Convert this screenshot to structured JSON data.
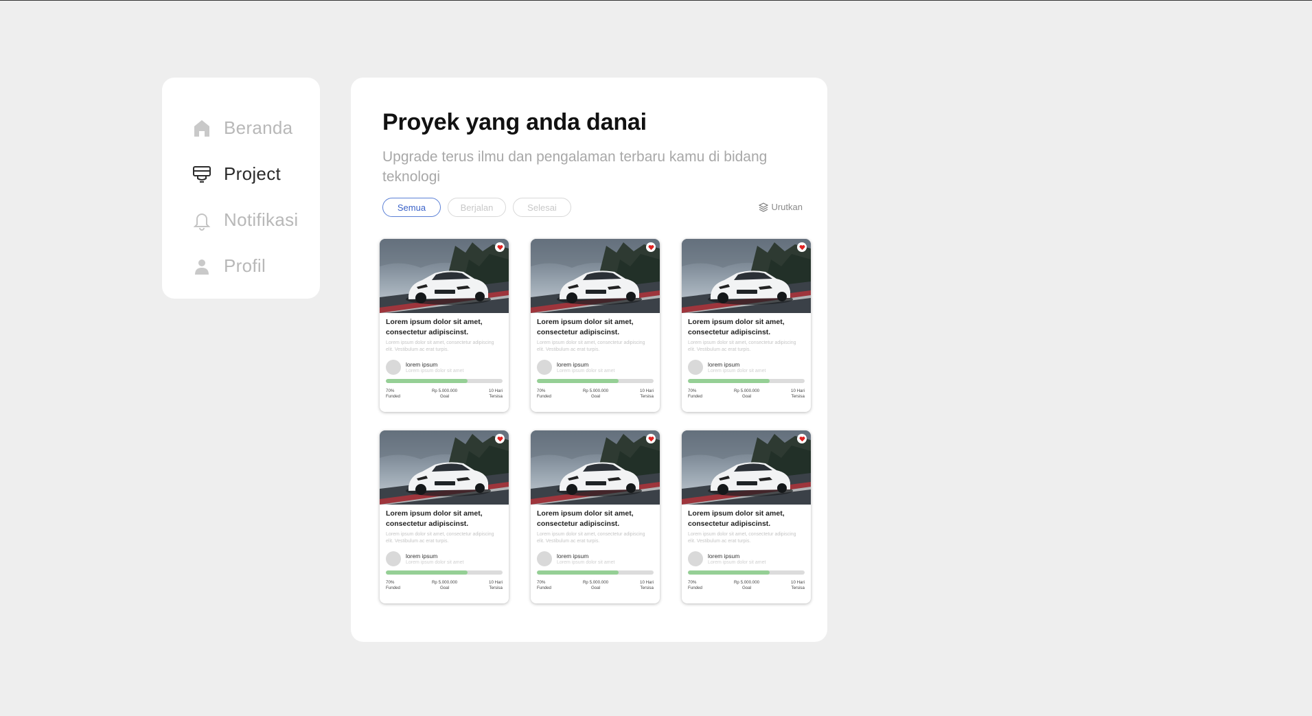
{
  "sidebar": {
    "items": [
      {
        "label": "Beranda",
        "icon": "home-icon",
        "active": false
      },
      {
        "label": "Project",
        "icon": "project-icon",
        "active": true
      },
      {
        "label": "Notifikasi",
        "icon": "bell-icon",
        "active": false
      },
      {
        "label": "Profil",
        "icon": "user-icon",
        "active": false
      }
    ]
  },
  "main": {
    "title": "Proyek yang anda danai",
    "subtitle": "Upgrade terus ilmu dan pengalaman terbaru kamu di bidang teknologi",
    "filters": [
      "Semua",
      "Berjalan",
      "Selesai"
    ],
    "active_filter": "Semua",
    "sort_label": "Urutkan"
  },
  "cards": [
    {
      "title": "Lorem ipsum dolor sit amet, consectetur adipiscinst.",
      "description": "Lorem ipsum dolor sit amet, consectetur adipiscing elit. Vestibulum ac erat turpis.",
      "author_name": "lorem ipsum",
      "author_sub": "Lorem ipsum dolor sit amet",
      "progress": 0.7,
      "funded_value": "70%",
      "funded_label": "Funded",
      "goal_value": "Rp 5.000.000",
      "goal_label": "Goal",
      "days_value": "10 Hari",
      "days_label": "Tersisa"
    },
    {
      "title": "Lorem ipsum dolor sit amet, consectetur adipiscinst.",
      "description": "Lorem ipsum dolor sit amet, consectetur adipiscing elit. Vestibulum ac erat turpis.",
      "author_name": "lorem ipsum",
      "author_sub": "Lorem ipsum dolor sit amet",
      "progress": 0.7,
      "funded_value": "70%",
      "funded_label": "Funded",
      "goal_value": "Rp 5.000.000",
      "goal_label": "Goal",
      "days_value": "10 Hari",
      "days_label": "Tersisa"
    },
    {
      "title": "Lorem ipsum dolor sit amet, consectetur adipiscinst.",
      "description": "Lorem ipsum dolor sit amet, consectetur adipiscing elit. Vestibulum ac erat turpis.",
      "author_name": "lorem ipsum",
      "author_sub": "Lorem ipsum dolor sit amet",
      "progress": 0.7,
      "funded_value": "70%",
      "funded_label": "Funded",
      "goal_value": "Rp 5.000.000",
      "goal_label": "Goal",
      "days_value": "10 Hari",
      "days_label": "Tersisa"
    },
    {
      "title": "Lorem ipsum dolor sit amet, consectetur adipiscinst.",
      "description": "Lorem ipsum dolor sit amet, consectetur adipiscing elit. Vestibulum ac erat turpis.",
      "author_name": "lorem ipsum",
      "author_sub": "Lorem ipsum dolor sit amet",
      "progress": 0.7,
      "funded_value": "70%",
      "funded_label": "Funded",
      "goal_value": "Rp 5.000.000",
      "goal_label": "Goal",
      "days_value": "10 Hari",
      "days_label": "Tersisa"
    },
    {
      "title": "Lorem ipsum dolor sit amet, consectetur adipiscinst.",
      "description": "Lorem ipsum dolor sit amet, consectetur adipiscing elit. Vestibulum ac erat turpis.",
      "author_name": "lorem ipsum",
      "author_sub": "Lorem ipsum dolor sit amet",
      "progress": 0.7,
      "funded_value": "70%",
      "funded_label": "Funded",
      "goal_value": "Rp 5.000.000",
      "goal_label": "Goal",
      "days_value": "10 Hari",
      "days_label": "Tersisa"
    },
    {
      "title": "Lorem ipsum dolor sit amet, consectetur adipiscinst.",
      "description": "Lorem ipsum dolor sit amet, consectetur adipiscing elit. Vestibulum ac erat turpis.",
      "author_name": "lorem ipsum",
      "author_sub": "Lorem ipsum dolor sit amet",
      "progress": 0.7,
      "funded_value": "70%",
      "funded_label": "Funded",
      "goal_value": "Rp 5.000.000",
      "goal_label": "Goal",
      "days_value": "10 Hari",
      "days_label": "Tersisa"
    }
  ],
  "colors": {
    "background": "#eeeeee",
    "active_chip": "#3a62c8",
    "progress": "#95cf95",
    "heart": "#e02424"
  }
}
